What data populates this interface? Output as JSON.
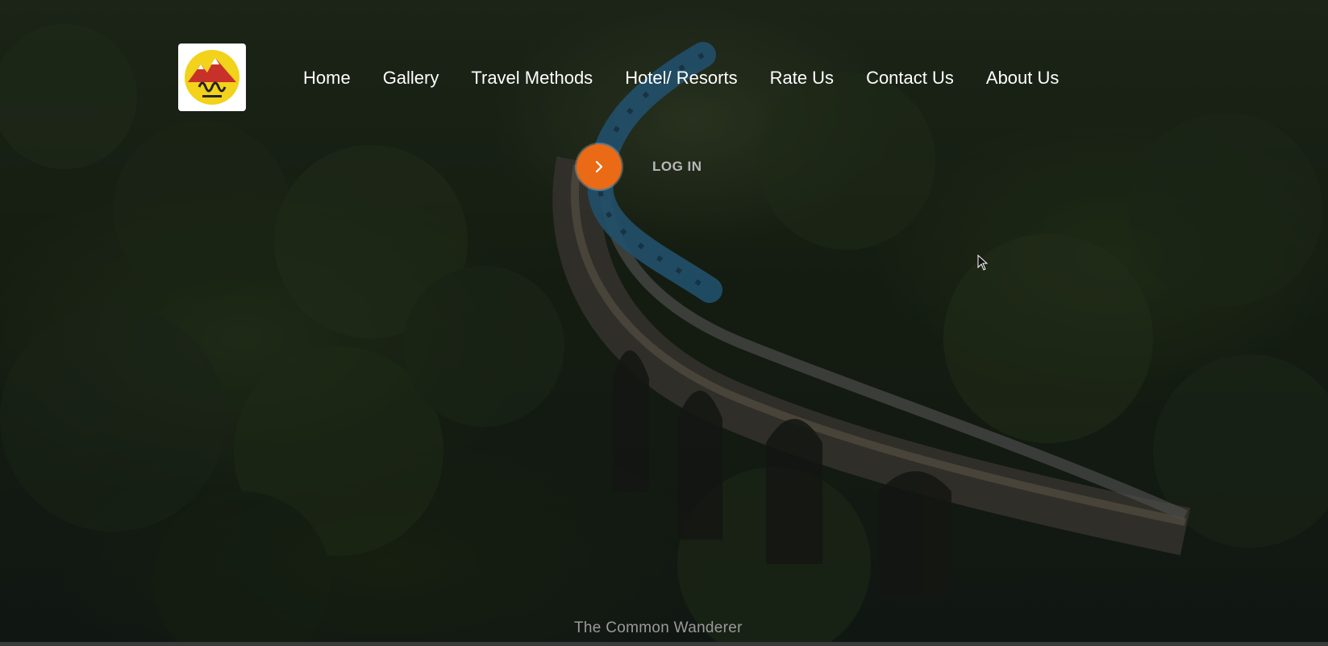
{
  "nav": {
    "logo_icon": "mountain-logo-icon",
    "items": [
      {
        "label": "Home"
      },
      {
        "label": "Gallery"
      },
      {
        "label": "Travel Methods"
      },
      {
        "label": "Hotel/ Resorts"
      },
      {
        "label": "Rate Us"
      },
      {
        "label": "Contact Us"
      },
      {
        "label": "About Us"
      }
    ]
  },
  "login": {
    "icon": "chevron-right-icon",
    "label": "LOG IN",
    "button_color": "#ea6a16"
  },
  "hero": {
    "tagline": "The Common Wanderer",
    "background": "jungle-train-bridge-image"
  },
  "colors": {
    "nav_text": "#ffffff",
    "accent": "#ea6a16",
    "logo_bg": "#ffffff",
    "logo_sun": "#f2d21a",
    "logo_mountain": "#c8302a"
  }
}
